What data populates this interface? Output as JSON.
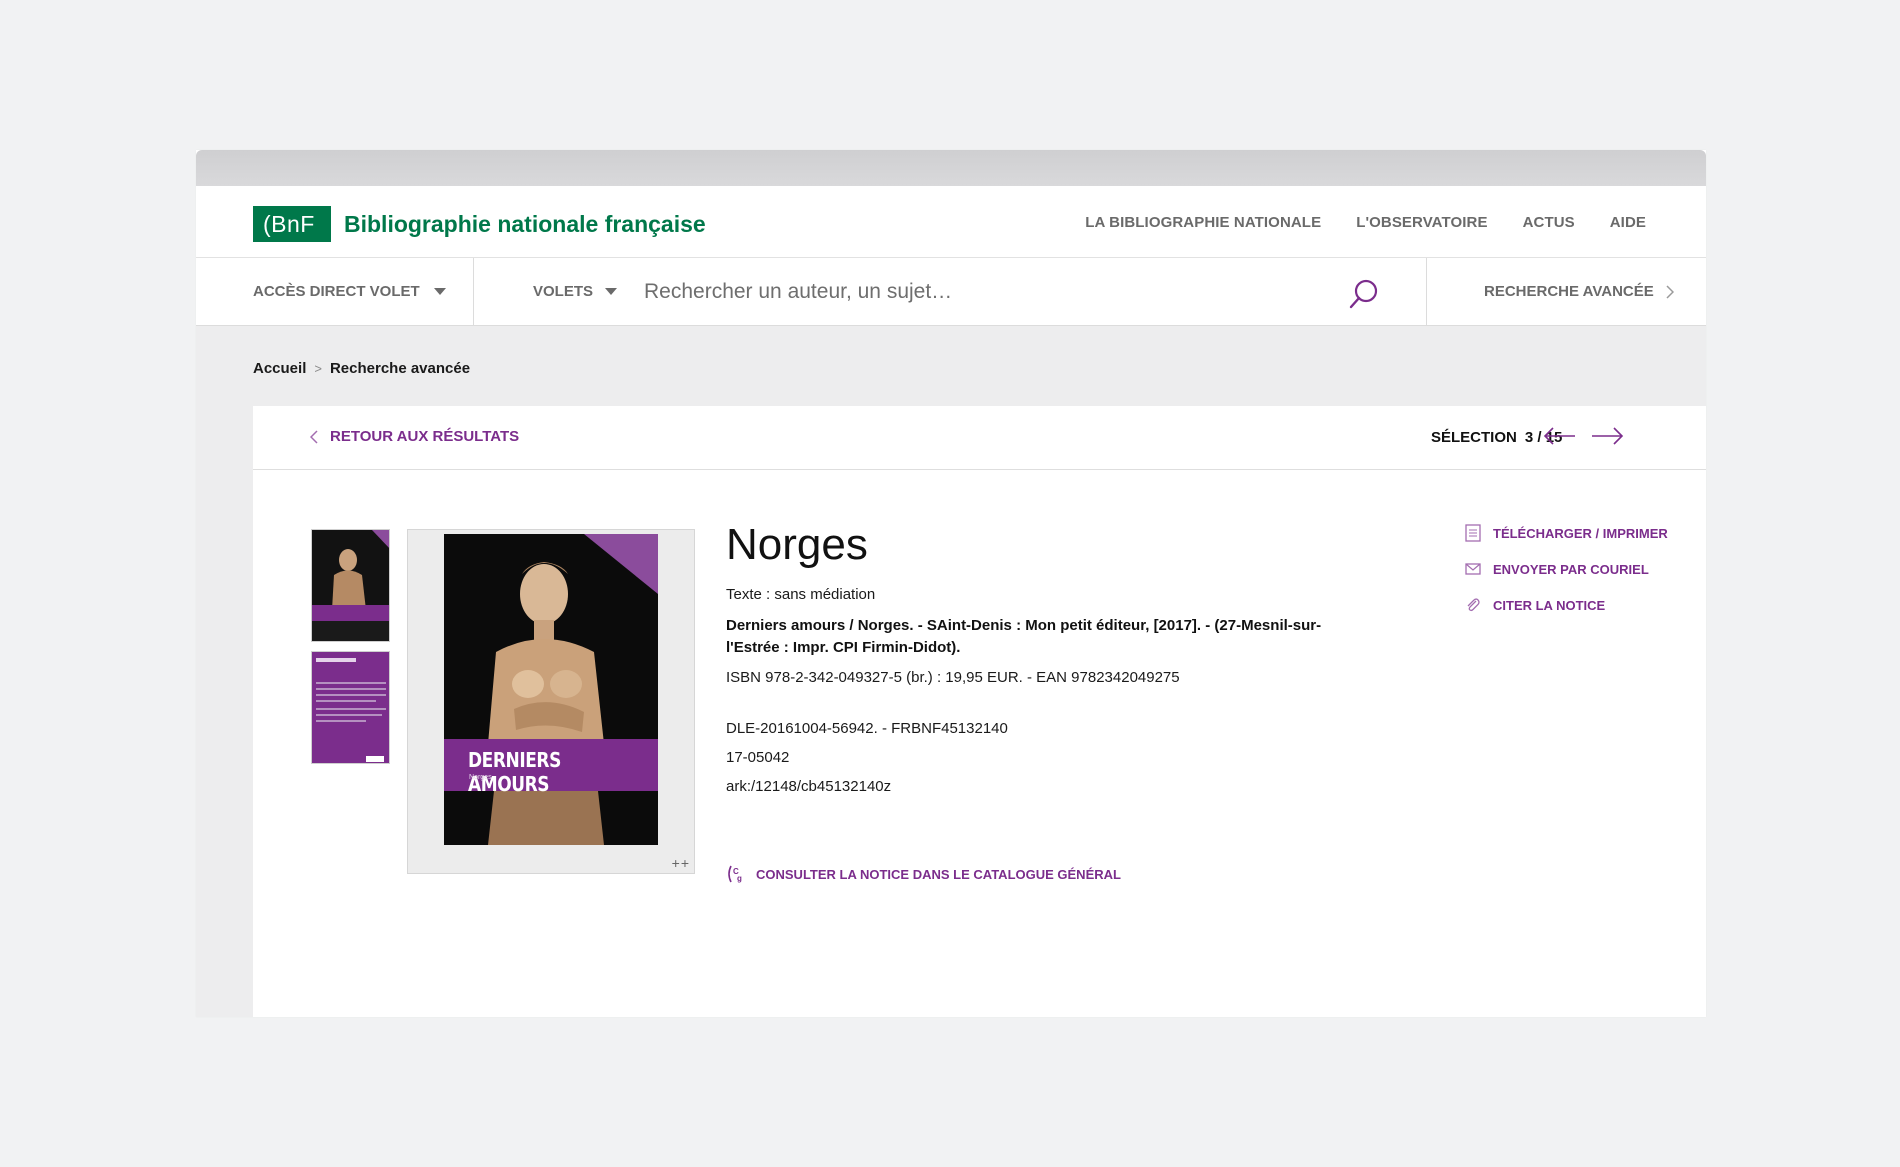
{
  "header": {
    "logo_text": "(BnF",
    "site_title": "Bibliographie nationale française",
    "nav": [
      "LA BIBLIOGRAPHIE NATIONALE",
      "L'OBSERVATOIRE",
      "ACTUS",
      "AIDE"
    ]
  },
  "search": {
    "acces_label": "ACCÈS DIRECT VOLET",
    "volets_label": "VOLETS",
    "placeholder": "Rechercher un auteur, un sujet…",
    "advanced_label": "RECHERCHE AVANCÉE"
  },
  "breadcrumb": {
    "home": "Accueil",
    "separator": ">",
    "current": "Recherche avancée"
  },
  "record_nav": {
    "back_label": "RETOUR AUX RÉSULTATS",
    "selection_label": "SÉLECTION",
    "selection_value": "3 / 15"
  },
  "cover": {
    "title": "DERNIERS AMOURS",
    "author": "Norges",
    "zoom": "++"
  },
  "record": {
    "title": "Norges",
    "type": "Texte : sans médiation",
    "description": "Derniers amours / Norges. - SAint-Denis : Mon petit éditeur, [2017]. - (27-Mesnil-sur-l'Estrée : Impr. CPI Firmin-Didot).",
    "isbn": "ISBN 978-2-342-049327-5 (br.) : 19,95 EUR. - EAN 9782342049275",
    "dle": "DLE-20161004-56942. - FRBNF45132140",
    "number": "17-05042",
    "ark": "ark:/12148/cb45132140z",
    "consult_label": "CONSULTER LA NOTICE DANS LE CATALOGUE GÉNÉRAL"
  },
  "actions": {
    "download_label": "TÉLÉCHARGER / IMPRIMER",
    "email_label": "ENVOYER PAR COURIEL",
    "cite_label": "CITER LA NOTICE"
  },
  "colors": {
    "brand_green": "#00784a",
    "accent_purple": "#7b2d8c",
    "page_background": "#f1f2f3",
    "body_gray": "#ededee"
  },
  "icons": {
    "search": "search-icon",
    "back": "chevron-left-icon",
    "prev": "arrow-left-icon",
    "next": "arrow-right-icon",
    "download": "document-icon",
    "email": "envelope-icon",
    "cite": "paperclip-icon",
    "catalogue": "catalogue-icon"
  }
}
